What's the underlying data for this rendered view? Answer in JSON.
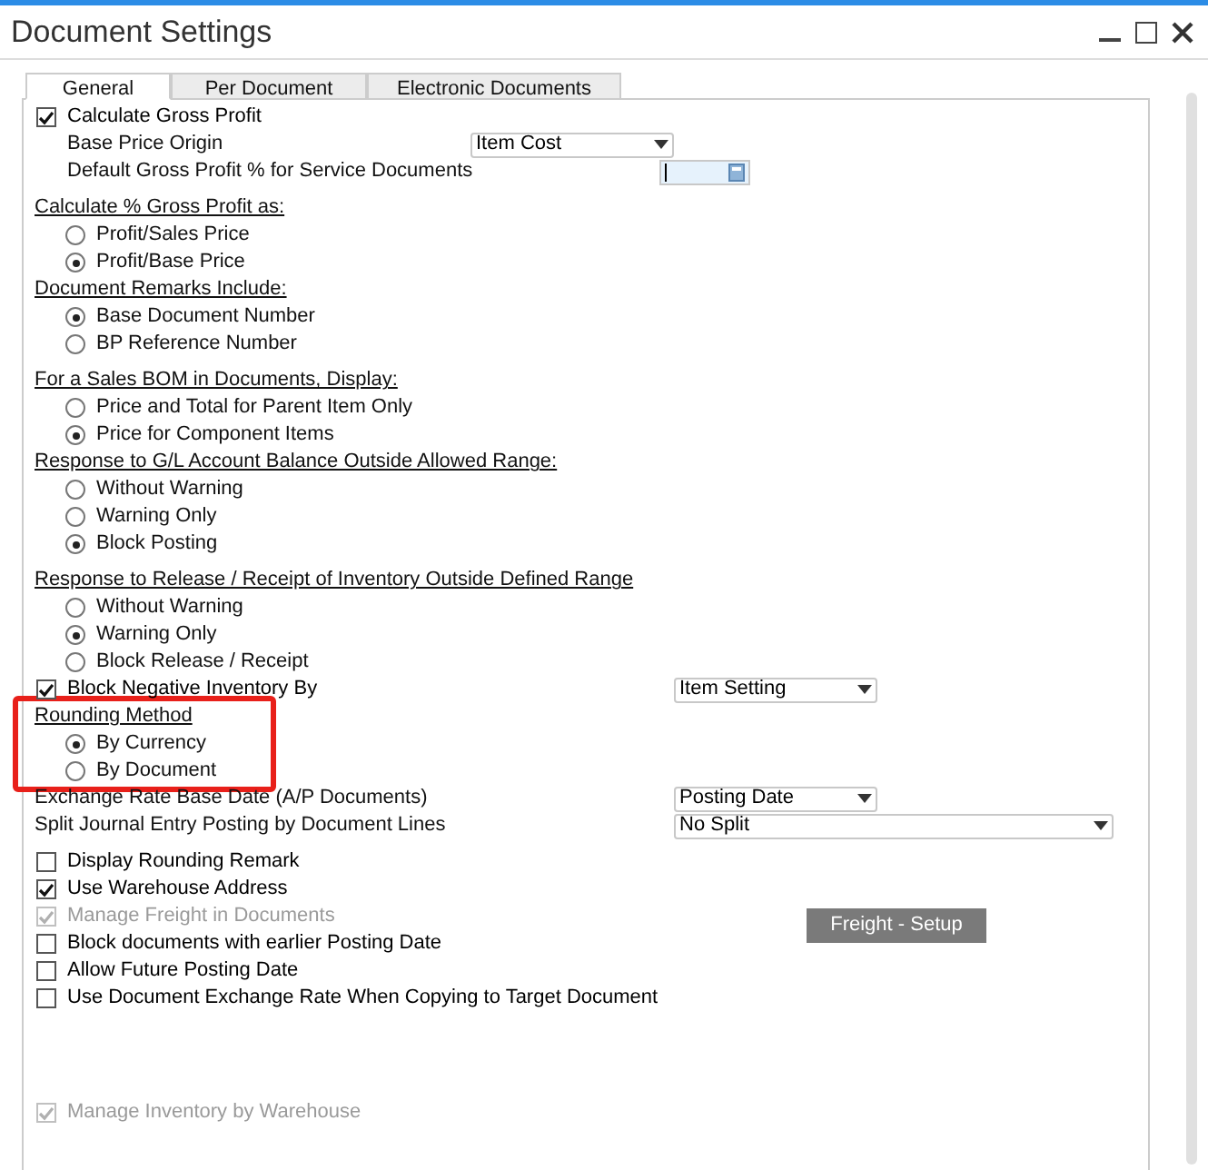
{
  "window": {
    "title": "Document Settings"
  },
  "tabs": [
    {
      "label": "General",
      "selected": true
    },
    {
      "label": "Per Document",
      "selected": false
    },
    {
      "label": "Electronic Documents",
      "selected": false
    }
  ],
  "sections": [
    [
      {
        "kind": "checkbox",
        "label": "Calculate Gross Profit",
        "checked": true,
        "disabled": false
      },
      {
        "kind": "near_field",
        "label": "Base Price Origin",
        "select": {
          "value": "Item Cost",
          "wide": false
        }
      },
      {
        "kind": "number_field",
        "label": "Default Gross Profit % for Service Documents"
      }
    ],
    [
      {
        "kind": "heading",
        "label": "Calculate % Gross Profit as:"
      },
      {
        "kind": "radio",
        "label": "Profit/Sales Price",
        "selected": false
      },
      {
        "kind": "radio",
        "label": "Profit/Base Price",
        "selected": true
      },
      {
        "kind": "heading",
        "label": "Document Remarks Include:"
      },
      {
        "kind": "radio",
        "label": "Base Document Number",
        "selected": true
      },
      {
        "kind": "radio",
        "label": "BP Reference Number",
        "selected": false
      }
    ],
    [
      {
        "kind": "heading",
        "label": "For a Sales BOM in Documents, Display:"
      },
      {
        "kind": "radio",
        "label": "Price and Total for Parent Item Only",
        "selected": false
      },
      {
        "kind": "radio",
        "label": "Price for Component Items",
        "selected": true
      },
      {
        "kind": "heading",
        "label": "Response to G/L Account Balance Outside Allowed Range:"
      },
      {
        "kind": "radio",
        "label": "Without Warning",
        "selected": false
      },
      {
        "kind": "radio",
        "label": "Warning Only",
        "selected": false
      },
      {
        "kind": "radio",
        "label": "Block Posting",
        "selected": true
      }
    ],
    [
      {
        "kind": "heading",
        "label": "Response to Release / Receipt of Inventory Outside Defined Range"
      },
      {
        "kind": "radio",
        "label": "Without Warning",
        "selected": false
      },
      {
        "kind": "radio",
        "label": "Warning Only",
        "selected": true
      },
      {
        "kind": "radio",
        "label": "Block Release / Receipt",
        "selected": false
      },
      {
        "kind": "checkbox",
        "label": "Block Negative Inventory By",
        "checked": true,
        "disabled": false,
        "select": {
          "value": "Item Setting",
          "wide": false
        }
      },
      {
        "kind": "highlight",
        "rows": [
          {
            "kind": "heading",
            "label": "Rounding Method"
          },
          {
            "kind": "radio",
            "label": "By Currency",
            "selected": true
          },
          {
            "kind": "radio",
            "label": "By Document",
            "selected": false
          }
        ]
      },
      {
        "kind": "field",
        "label": "Exchange Rate Base Date (A/P Documents)",
        "select": {
          "value": "Posting Date",
          "wide": false
        }
      },
      {
        "kind": "field",
        "label": "Split Journal Entry Posting by Document Lines",
        "select": {
          "value": "No Split",
          "wide": true
        }
      }
    ],
    [
      {
        "kind": "checkbox",
        "label": "Display Rounding Remark",
        "checked": false,
        "disabled": false
      },
      {
        "kind": "checkbox",
        "label": "Use Warehouse Address",
        "checked": true,
        "disabled": false
      },
      {
        "kind": "checkbox",
        "label": "Manage Freight in Documents",
        "checked": true,
        "disabled": true,
        "button": "Freight - Setup"
      },
      {
        "kind": "checkbox",
        "label": "Block documents with earlier Posting Date",
        "checked": false,
        "disabled": false
      },
      {
        "kind": "checkbox",
        "label": "Allow Future Posting Date",
        "checked": false,
        "disabled": false
      },
      {
        "kind": "checkbox",
        "label": "Use Document Exchange Rate When Copying to Target Document",
        "checked": false,
        "disabled": false
      }
    ]
  ],
  "footer": [
    {
      "kind": "checkbox",
      "label": "Manage Inventory by Warehouse",
      "checked": true,
      "disabled": true
    }
  ]
}
